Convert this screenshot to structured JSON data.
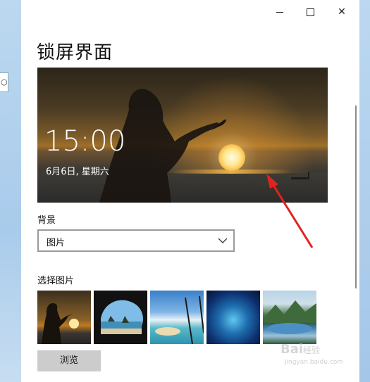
{
  "window": {
    "title": "锁屏界面",
    "controls": {
      "minimize_icon": "minimize-icon",
      "maximize_icon": "maximize-icon",
      "close_icon": "close-icon",
      "close_glyph": "✕"
    }
  },
  "preview": {
    "time": "15:00",
    "date": "6月6日, 星期六"
  },
  "background_section": {
    "label": "背景",
    "selected": "图片"
  },
  "picture_section": {
    "label": "选择图片",
    "thumbnails": [
      "sunset-silhouette",
      "sea-cave",
      "tropical-beach",
      "ice-cave",
      "mountain-lake"
    ]
  },
  "browse_button": "浏览",
  "left_edge_text": "○",
  "watermark": {
    "brand": "Bai",
    "brand_suffix": "经验",
    "url": "jingyan.baidu.com"
  },
  "colors": {
    "accent_arrow": "#e0231f",
    "button_bg": "#cccccc",
    "dropdown_border": "#9a9a9a"
  }
}
